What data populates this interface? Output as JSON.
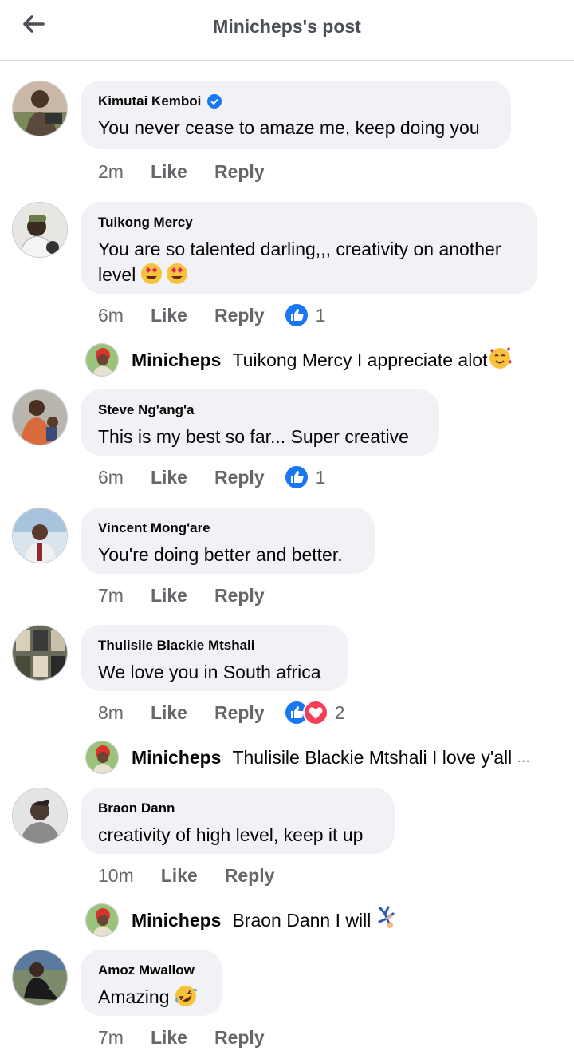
{
  "header": {
    "title": "Minicheps's post",
    "back_icon": "arrow-left-icon"
  },
  "comments": [
    {
      "name": "Kimutai Kemboi",
      "verified": true,
      "text": "You never cease to amaze me, keep doing you",
      "time": "2m",
      "like": "Like",
      "reply": "Reply"
    },
    {
      "name": "Tuikong Mercy",
      "text": "You are so talented darling,,, creativity on another level",
      "emoji": "heart-eyes-emoji",
      "time": "6m",
      "like": "Like",
      "reply": "Reply",
      "reaction_count": "1"
    },
    {
      "name": "Steve Ng'ang'a",
      "text": "This is my best so far... Super creative",
      "time": "6m",
      "like": "Like",
      "reply": "Reply",
      "reaction_count": "1"
    },
    {
      "name": "Vincent Mong'are",
      "text": "You're doing better and better.",
      "time": "7m",
      "like": "Like",
      "reply": "Reply"
    },
    {
      "name": "Thulisile Blackie Mtshali",
      "text": "We love you in South africa",
      "time": "8m",
      "like": "Like",
      "reply": "Reply",
      "reaction_count": "2"
    },
    {
      "name": "Braon Dann",
      "text": "creativity of high level, keep it up",
      "time": "10m",
      "like": "Like",
      "reply": "Reply"
    },
    {
      "name": "Amoz Mwallow",
      "text": "Amazing",
      "emoji": "rofl-emoji",
      "time": "7m",
      "like": "Like",
      "reply": "Reply"
    }
  ],
  "replies": [
    {
      "name": "Minicheps",
      "text": "Tuikong Mercy I appreciate alot",
      "emoji": "smiling-hearts-emoji"
    },
    {
      "name": "Minicheps",
      "text": "Thulisile Blackie Mtshali I love y'all",
      "ellipsis": "..."
    },
    {
      "name": "Minicheps",
      "text": "Braon Dann I will",
      "emoji": "cartwheel-emoji"
    }
  ],
  "colors": {
    "like_blue": "#1877f2",
    "love_red": "#f33e58",
    "meta_gray": "#65676b",
    "bubble_bg": "#f0f2f5"
  }
}
